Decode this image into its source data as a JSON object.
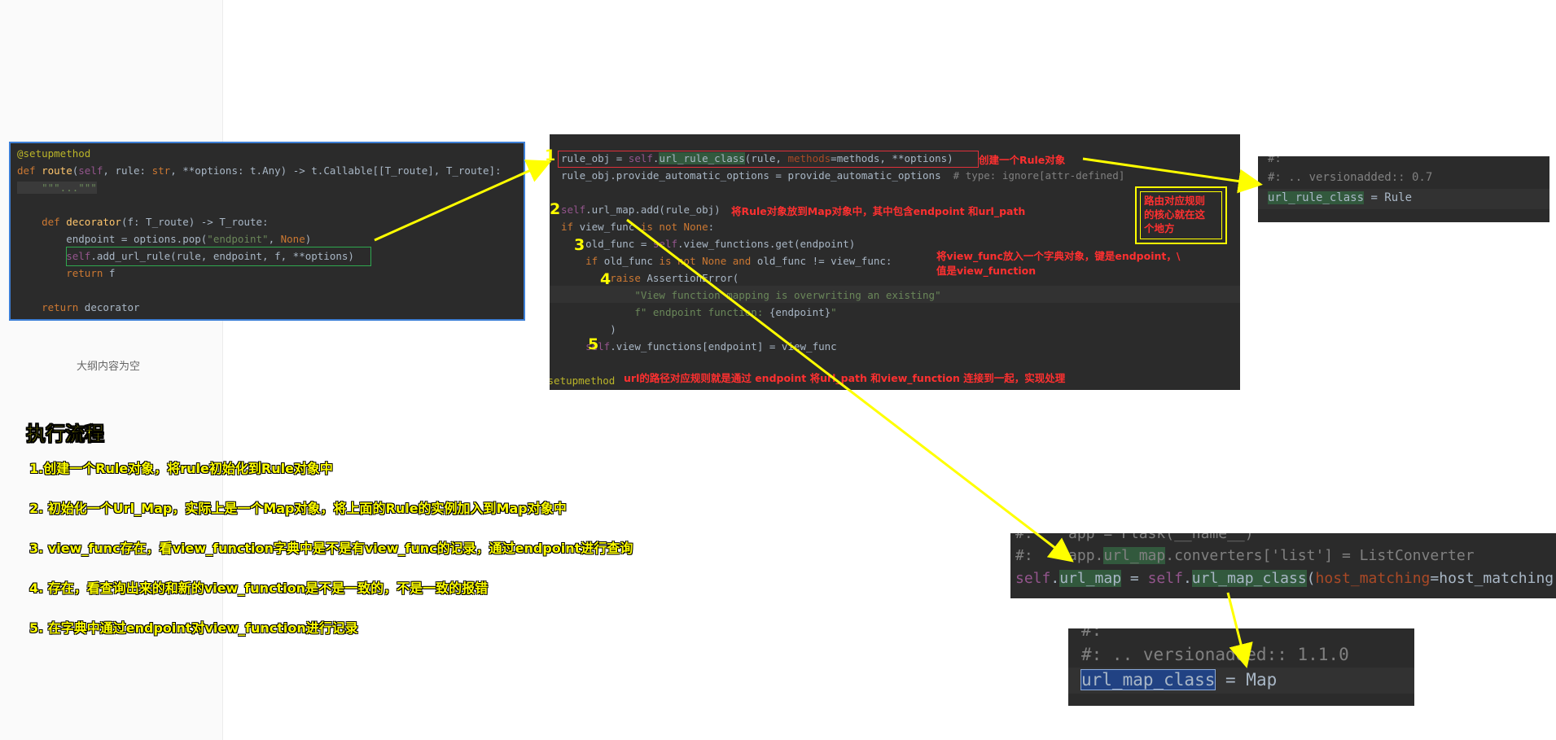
{
  "sidebar": {
    "outline_empty": "大纲内容为空"
  },
  "snippet1": {
    "lines": [
      "@setupmethod",
      "def route(self, rule: str, **options: t.Any) -> t.Callable[[T_route], T_route]:",
      "    \"\"\"...\"\"\"",
      "",
      "    def decorator(f: T_route) -> T_route:",
      "        endpoint = options.pop(\"endpoint\", None)",
      "        self.add_url_rule(rule, endpoint, f, **options)",
      "        return f",
      "",
      "    return decorator"
    ]
  },
  "snippet2": {
    "lines": [
      "rule_obj = self.url_rule_class(rule, methods=methods, **options)",
      "rule_obj.provide_automatic_options = provide_automatic_options  # type: ignore[attr-defined]",
      "",
      "self.url_map.add(rule_obj)",
      "if view_func is not None:",
      "    old_func = self.view_functions.get(endpoint)",
      "    if old_func is not None and old_func != view_func:",
      "        raise AssertionError(",
      "            \"View function mapping is overwriting an existing\"",
      "            f\" endpoint function: {endpoint}\"",
      "        )",
      "    self.view_functions[endpoint] = view_func",
      "",
      "@setupmethod"
    ]
  },
  "snippet3": {
    "lines": [
      "#:",
      "#: .. versionadded:: 0.7",
      "url_rule_class = Rule"
    ]
  },
  "snippet4": {
    "lines": [
      "#:    app = Flask(__name__)",
      "#:    app.url_map.converters['list'] = ListConverter",
      "self.url_map = self.url_map_class(host_matching=host_matching)"
    ]
  },
  "snippet5": {
    "lines": [
      "#:",
      "#: .. versionadded:: 1.1.0",
      "url_map_class = Map"
    ]
  },
  "annotations": {
    "create_rule": "创建一个Rule对象",
    "add_to_map": "将Rule对象放到Map对象中，其中包含endpoint 和url_path",
    "core_box": "路由对应规则\n的核心就在这\n个地方",
    "view_func_dict_1": "将view_func放入一个字典对象，键是endpoint，\\",
    "view_func_dict_2": "值是view_function",
    "summary": "url的路径对应规则就是通过 endpoint 将url_path 和view_function 连接到一起，实现处理",
    "numbers": [
      "1",
      "2",
      "3",
      "4",
      "5"
    ]
  },
  "flow": {
    "title": "执行流程",
    "steps": [
      "1.创建一个Rule对象，将rule初始化到Rule对象中",
      "2. 初始化一个Url_Map，实际上是一个Map对象，将上面的Rule的实例加入到Map对象中",
      "3. view_func存在，看view_function字典中是不是有view_func的记录，通过endpoint进行查询",
      "4. 存在，看查询出来的和新的view_function是不是一致的，不是一致的报错",
      "5. 在字典中通过endpoint对view_function进行记录"
    ]
  },
  "colors": {
    "code_bg": "#2b2b2b",
    "arrow": "#ffff00",
    "annotation_red": "#ff3030",
    "highlight_green": "#2fa84f"
  }
}
